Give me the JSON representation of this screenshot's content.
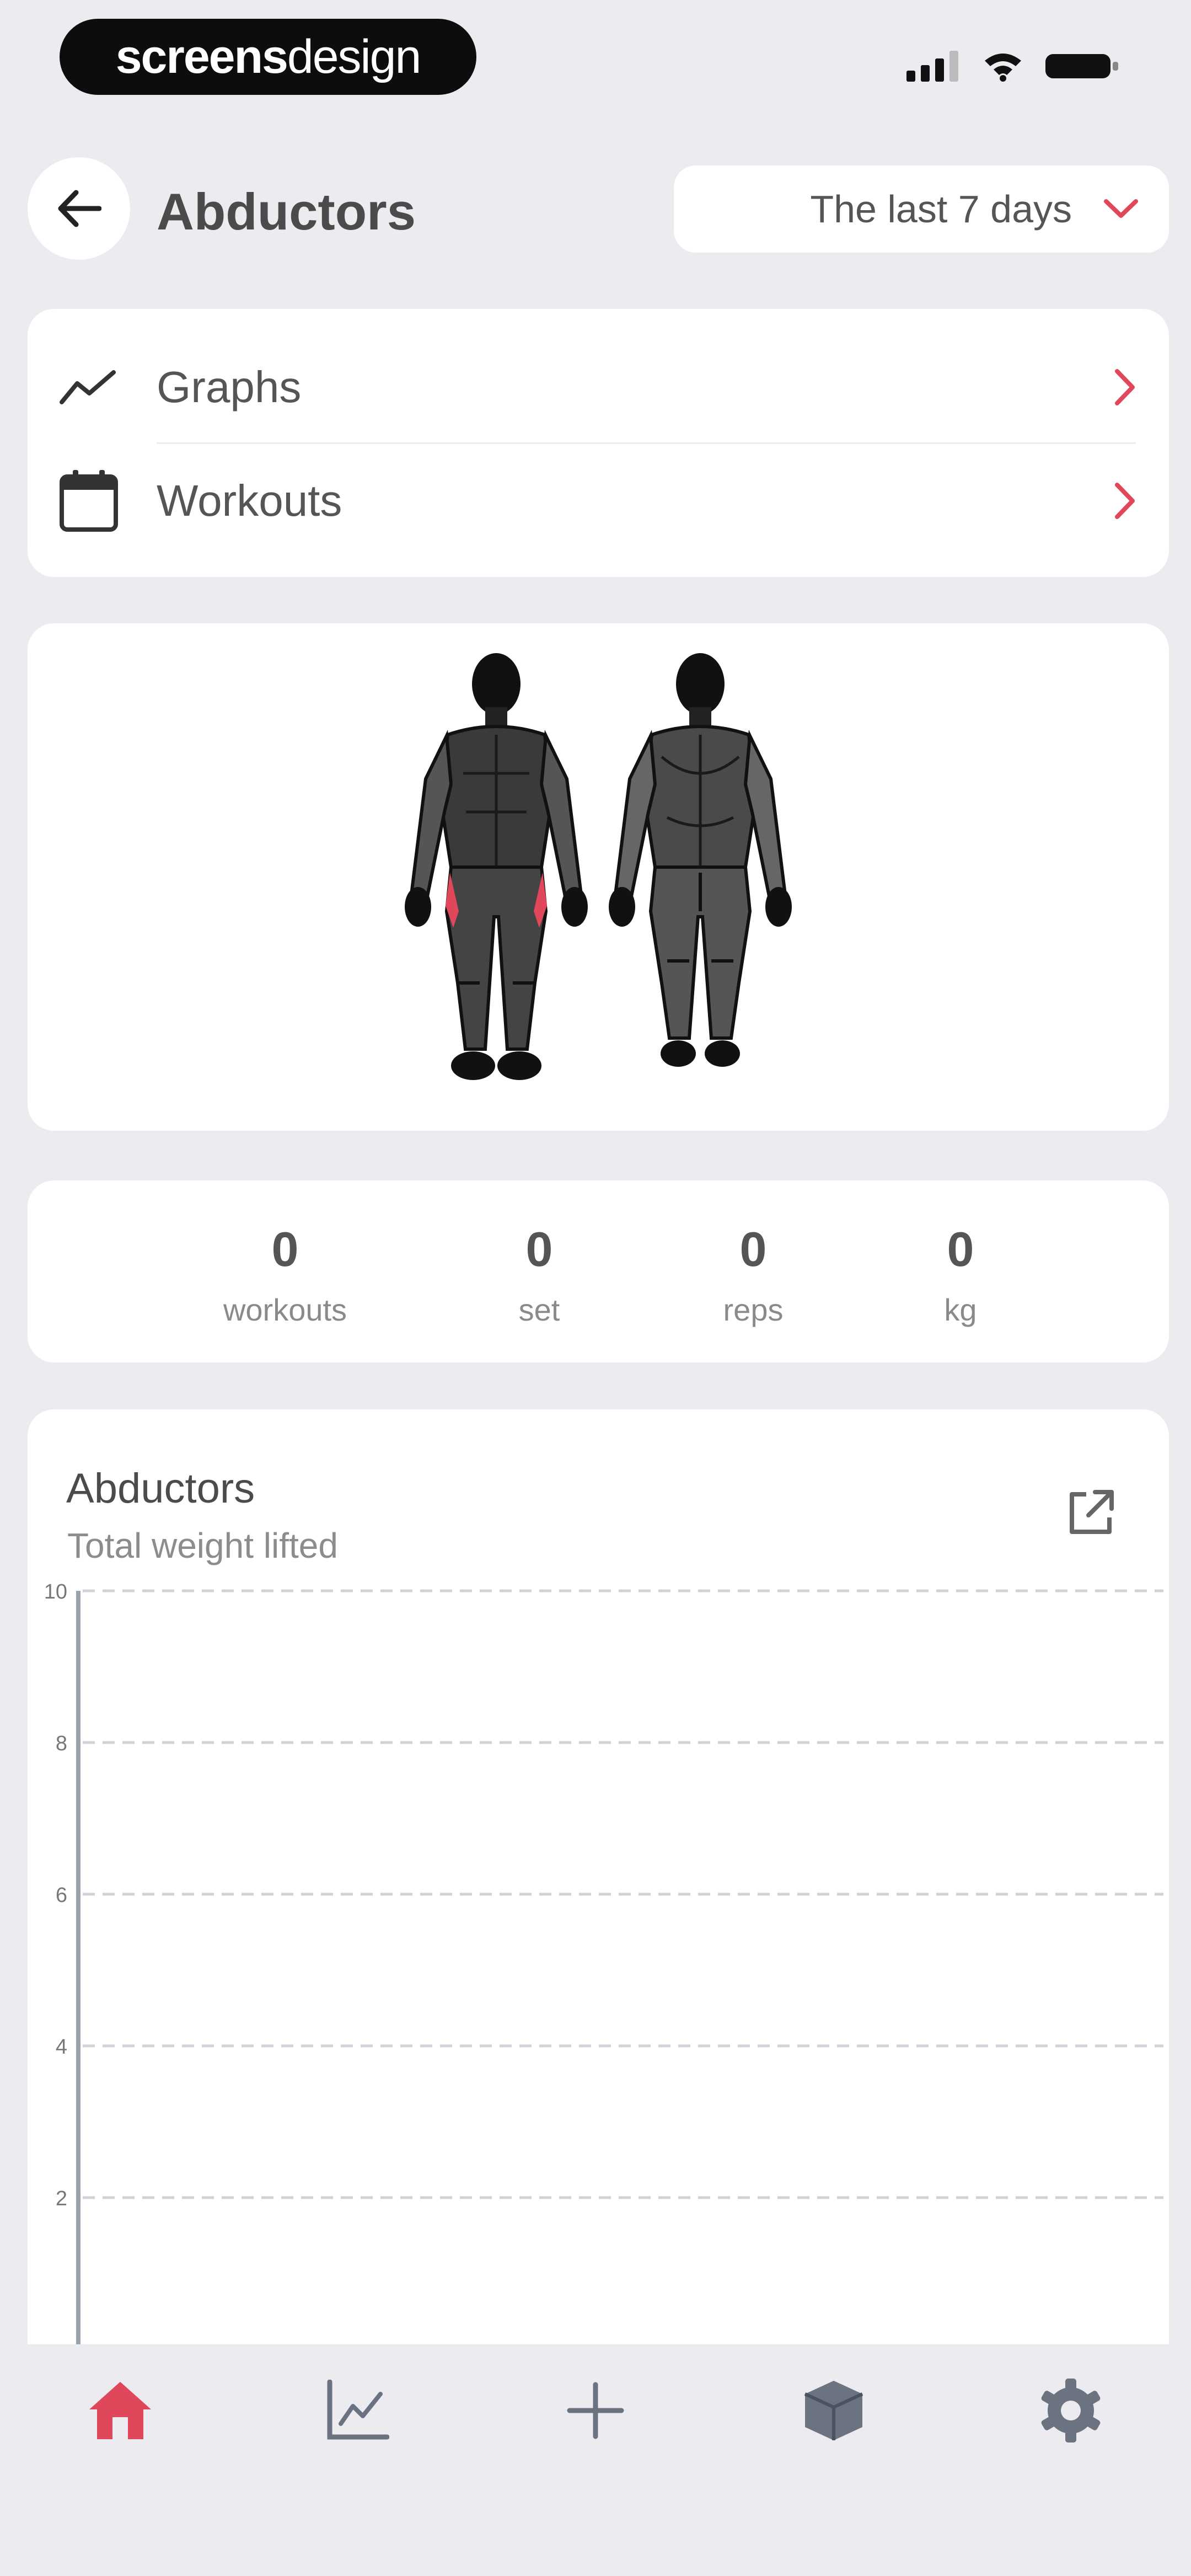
{
  "status_bar": {
    "brand_bold": "screens",
    "brand_light": "design"
  },
  "header": {
    "title": "Abductors",
    "date_range": "The last 7 days"
  },
  "nav": {
    "items": [
      {
        "label": "Graphs",
        "icon": "trend-line-icon"
      },
      {
        "label": "Workouts",
        "icon": "calendar-icon"
      }
    ]
  },
  "body_map": {
    "highlighted_muscle": "Abductors",
    "highlight_color": "#e0475b"
  },
  "stats": [
    {
      "value": "0",
      "label": "workouts"
    },
    {
      "value": "0",
      "label": "set"
    },
    {
      "value": "0",
      "label": "reps"
    },
    {
      "value": "0",
      "label": "kg"
    }
  ],
  "chart_data": {
    "type": "line",
    "title": "Abductors",
    "subtitle": "Total weight lifted",
    "ylim": [
      0,
      10
    ],
    "yticks": [
      "10",
      "8",
      "6",
      "4",
      "2",
      "0"
    ],
    "series": [],
    "grid": true
  },
  "tabbar": {
    "items": [
      {
        "icon": "home-icon",
        "active": true
      },
      {
        "icon": "chart-icon",
        "active": false
      },
      {
        "icon": "plus-icon",
        "active": false
      },
      {
        "icon": "box-icon",
        "active": false
      },
      {
        "icon": "gear-icon",
        "active": false
      }
    ]
  },
  "colors": {
    "accent": "#e0475b",
    "background": "#ebebf0",
    "card": "#ffffff",
    "icon_gray": "#6b7280"
  }
}
